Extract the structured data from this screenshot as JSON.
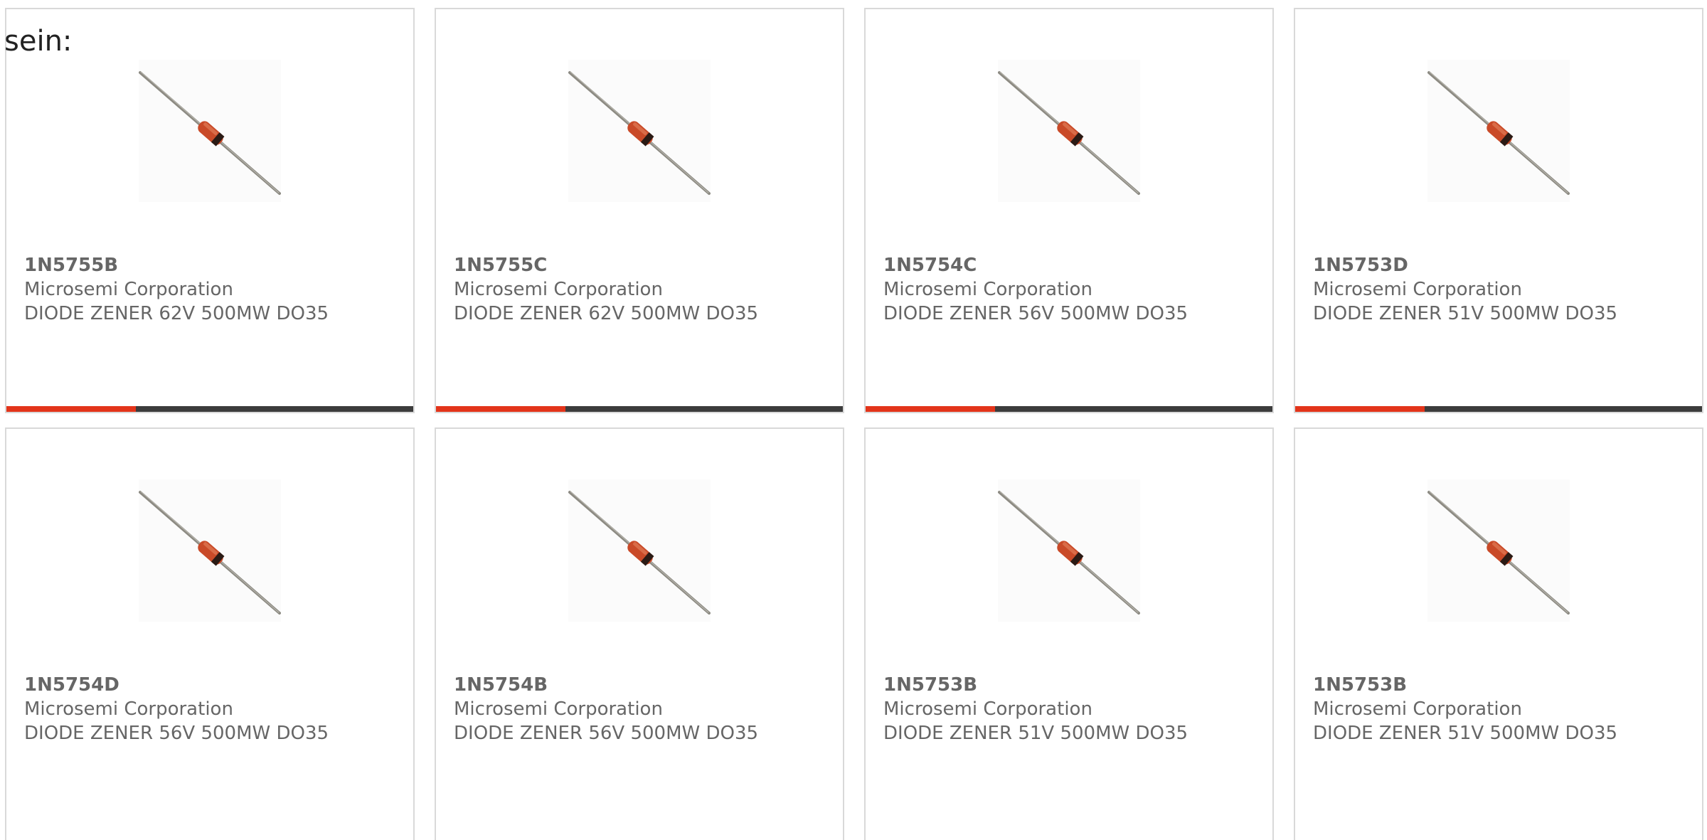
{
  "intro_text": "sein:",
  "colors": {
    "card_border": "#d9d9d9",
    "text": "#666666",
    "accent_bar": "#e3341a",
    "dark_bar": "#3c3c3c",
    "diode_body": "#c94a28",
    "diode_band": "#2a1a14",
    "lead": "#8c8a82"
  },
  "products": [
    {
      "part": "1N5755B",
      "maker": "Microsemi Corporation",
      "description": "DIODE ZENER 62V 500MW DO35",
      "image_icon": "zener-diode-do35-icon"
    },
    {
      "part": "1N5755C",
      "maker": "Microsemi Corporation",
      "description": "DIODE ZENER 62V 500MW DO35",
      "image_icon": "zener-diode-do35-icon"
    },
    {
      "part": "1N5754C",
      "maker": "Microsemi Corporation",
      "description": "DIODE ZENER 56V 500MW DO35",
      "image_icon": "zener-diode-do35-icon"
    },
    {
      "part": "1N5753D",
      "maker": "Microsemi Corporation",
      "description": "DIODE ZENER 51V 500MW DO35",
      "image_icon": "zener-diode-do35-icon"
    },
    {
      "part": "1N5754D",
      "maker": "Microsemi Corporation",
      "description": "DIODE ZENER 56V 500MW DO35",
      "image_icon": "zener-diode-do35-icon"
    },
    {
      "part": "1N5754B",
      "maker": "Microsemi Corporation",
      "description": "DIODE ZENER 56V 500MW DO35",
      "image_icon": "zener-diode-do35-icon"
    },
    {
      "part": "1N5753B",
      "maker": "Microsemi Corporation",
      "description": "DIODE ZENER 51V 500MW DO35",
      "image_icon": "zener-diode-do35-icon"
    },
    {
      "part": "1N5753B",
      "maker": "Microsemi Corporation",
      "description": "DIODE ZENER 51V 500MW DO35",
      "image_icon": "zener-diode-do35-icon"
    }
  ]
}
